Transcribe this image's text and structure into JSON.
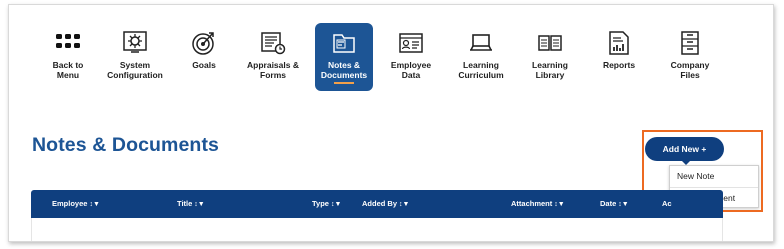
{
  "nav": {
    "items": [
      {
        "label_line1": "Back to",
        "label_line2": "Menu",
        "icon": "grid-icon",
        "active": false
      },
      {
        "label_line1": "System",
        "label_line2": "Configuration",
        "icon": "settings-icon",
        "active": false
      },
      {
        "label_line1": "Goals",
        "label_line2": "",
        "icon": "target-icon",
        "active": false
      },
      {
        "label_line1": "Appraisals &",
        "label_line2": "Forms",
        "icon": "appraisal-icon",
        "active": false
      },
      {
        "label_line1": "Notes &",
        "label_line2": "Documents",
        "icon": "folder-icon",
        "active": true
      },
      {
        "label_line1": "Employee",
        "label_line2": "Data",
        "icon": "id-card-icon",
        "active": false
      },
      {
        "label_line1": "Learning",
        "label_line2": "Curriculum",
        "icon": "laptop-icon",
        "active": false
      },
      {
        "label_line1": "Learning",
        "label_line2": "Library",
        "icon": "book-icon",
        "active": false
      },
      {
        "label_line1": "Reports",
        "label_line2": "",
        "icon": "report-icon",
        "active": false
      },
      {
        "label_line1": "Company",
        "label_line2": "Files",
        "icon": "cabinet-icon",
        "active": false
      }
    ]
  },
  "page": {
    "title": "Notes & Documents"
  },
  "add_new": {
    "label": "Add New +",
    "menu": [
      "New Note",
      "New Document"
    ]
  },
  "table": {
    "columns": [
      "Employee",
      "Title",
      "Type",
      "Added By",
      "Attachment",
      "Date",
      "Ac"
    ],
    "sort_glyph": "↕▼"
  },
  "colors": {
    "brand": "#1d5595",
    "header": "#0f3f7f",
    "accent_underline": "#f2a04a",
    "highlight": "#ed6a21"
  }
}
